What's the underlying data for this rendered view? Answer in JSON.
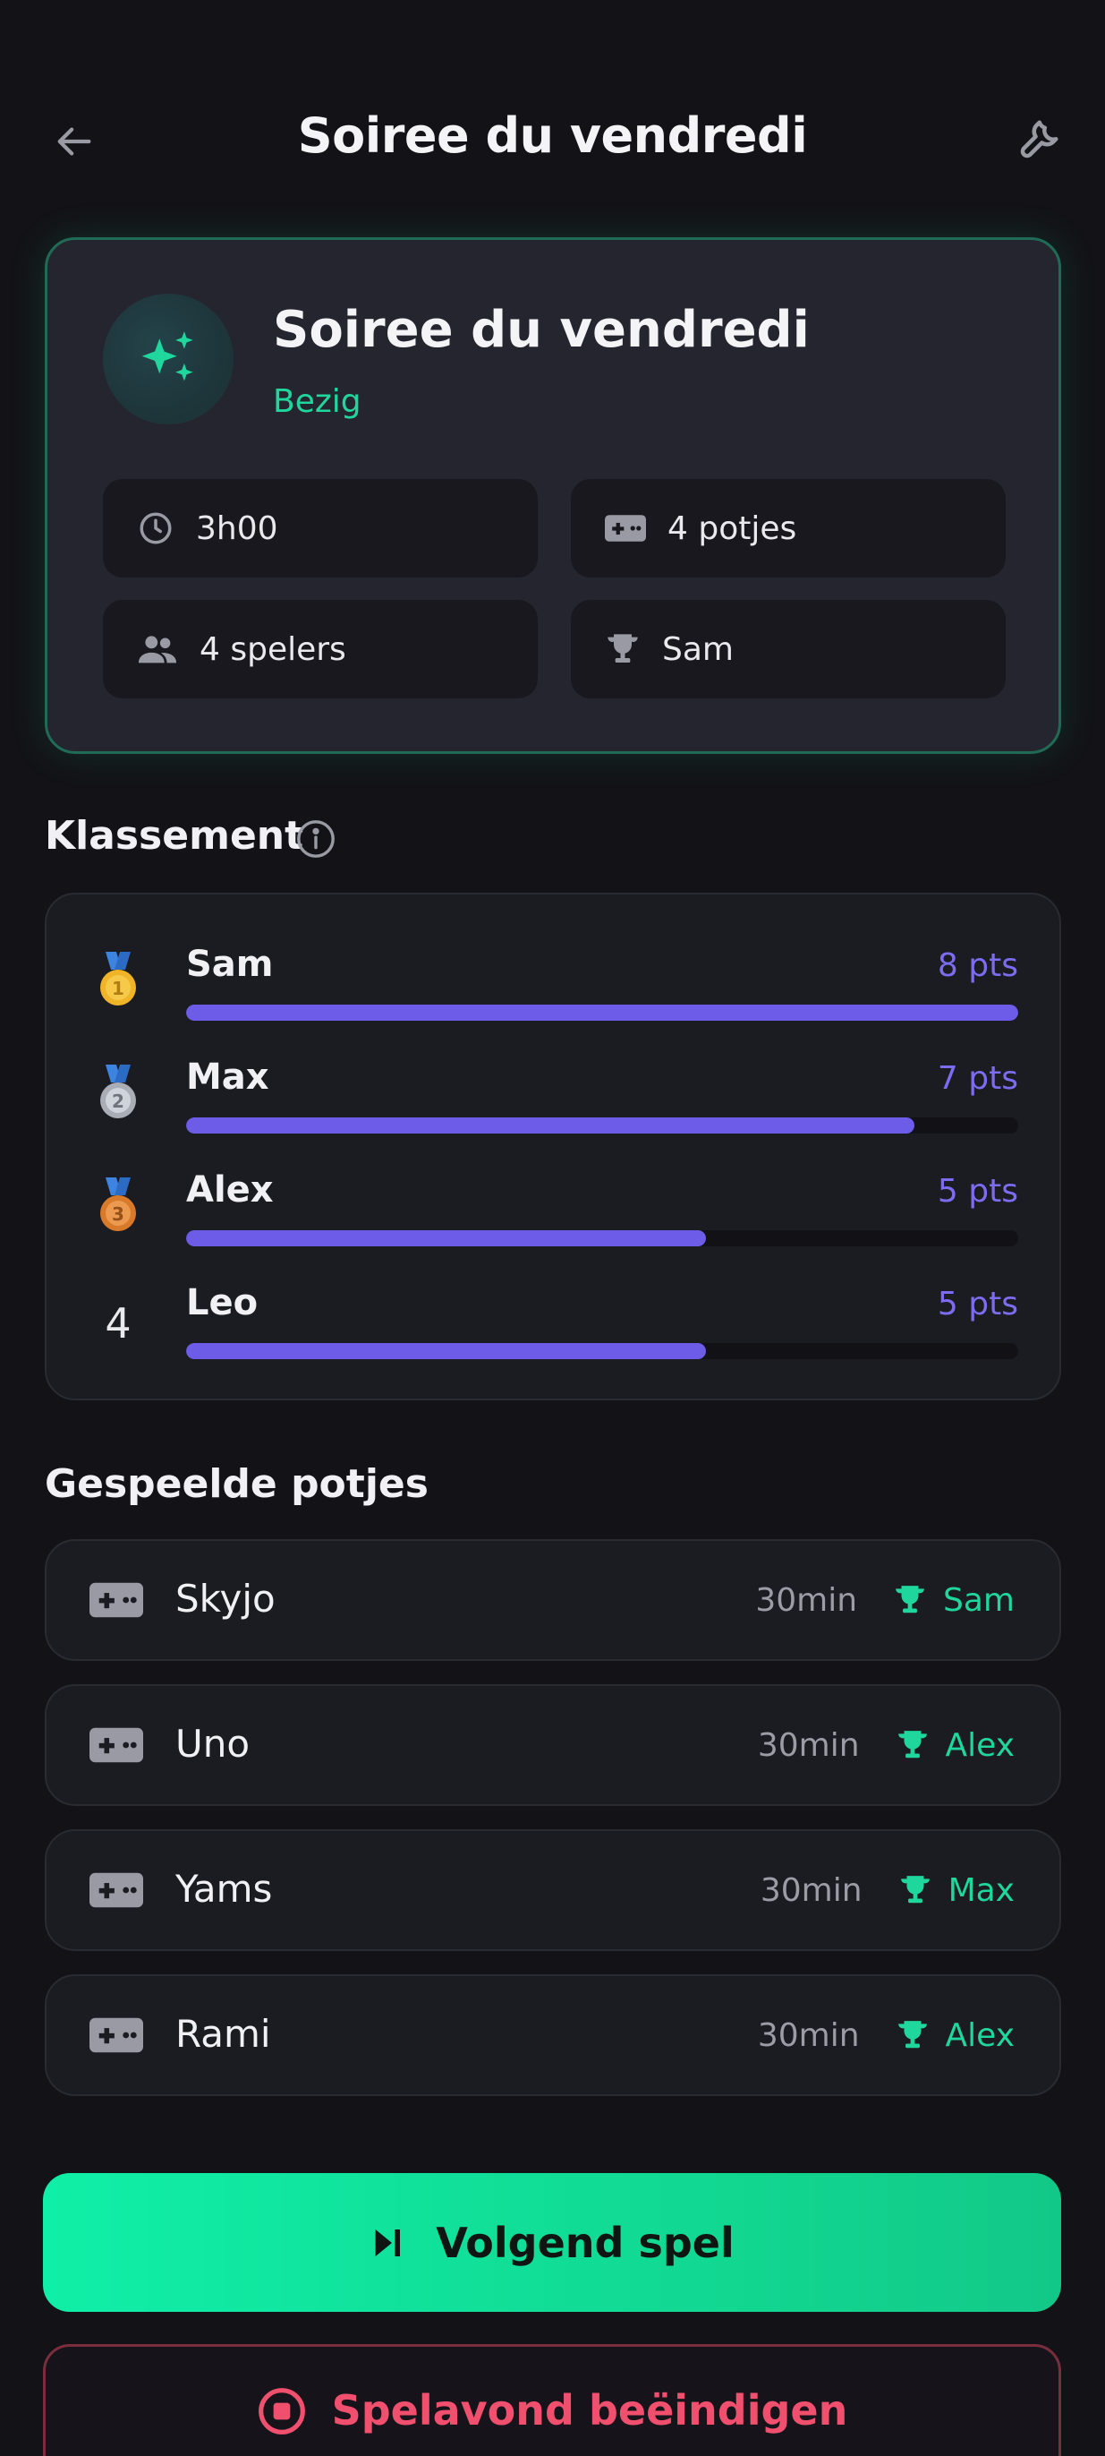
{
  "header": {
    "title": "Soiree du vendredi",
    "back_icon": "arrow-left-icon",
    "tools_icon": "wrench-icon"
  },
  "session": {
    "title": "Soiree du vendredi",
    "status": "Bezig",
    "icon": "sparkles-icon",
    "stats": {
      "duration": "3h00",
      "games": "4 potjes",
      "players": "4 spelers",
      "leader": "Sam"
    }
  },
  "leaderboard": {
    "title": "Klassement",
    "info_icon": "info-icon",
    "max_points": 8,
    "rows": [
      {
        "rank": "1",
        "medal": "gold-medal-icon",
        "name": "Sam",
        "points": 8,
        "points_label": "8 pts"
      },
      {
        "rank": "2",
        "medal": "silver-medal-icon",
        "name": "Max",
        "points": 7,
        "points_label": "7 pts"
      },
      {
        "rank": "3",
        "medal": "bronze-medal-icon",
        "name": "Alex",
        "points": 5,
        "points_label": "5 pts"
      },
      {
        "rank": "4",
        "medal": "",
        "name": "Leo",
        "points": 5,
        "points_label": "5 pts"
      }
    ]
  },
  "games": {
    "title": "Gespeelde potjes",
    "items": [
      {
        "name": "Skyjo",
        "duration": "30min",
        "winner": "Sam"
      },
      {
        "name": "Uno",
        "duration": "30min",
        "winner": "Alex"
      },
      {
        "name": "Yams",
        "duration": "30min",
        "winner": "Max"
      },
      {
        "name": "Rami",
        "duration": "30min",
        "winner": "Alex"
      }
    ]
  },
  "actions": {
    "next_label": "Volgend spel",
    "end_label": "Spelavond beëindigen"
  },
  "colors": {
    "accent": "#1fd69c",
    "bar": "#6c5ce7",
    "danger": "#f0506e"
  }
}
